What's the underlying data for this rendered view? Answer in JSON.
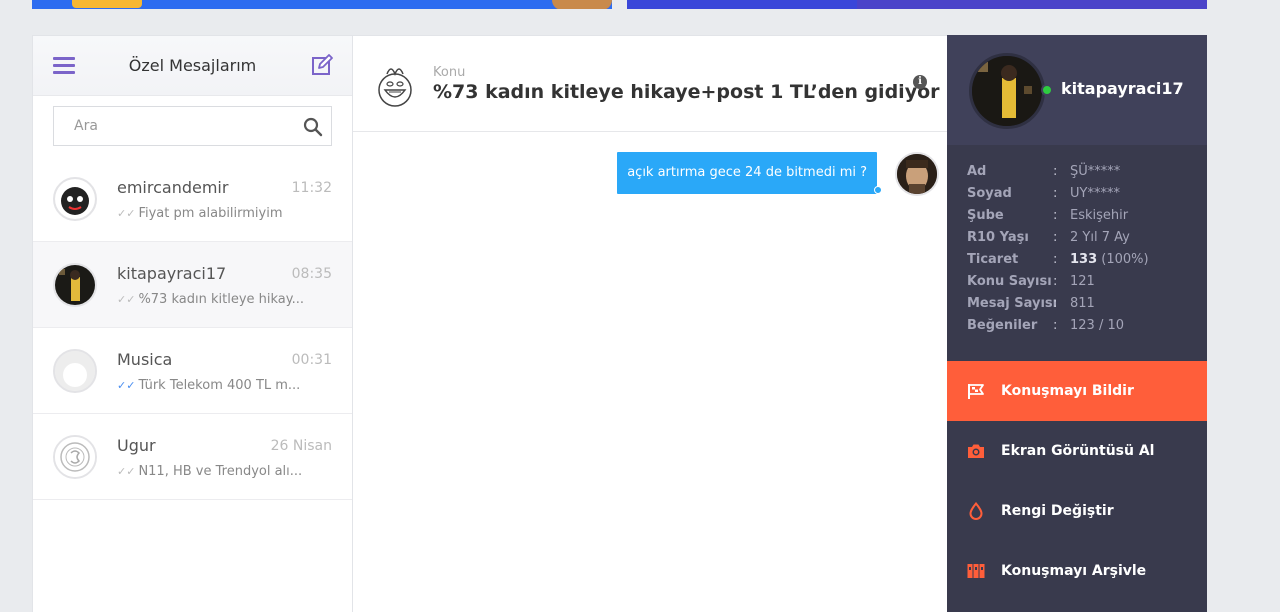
{
  "left_panel": {
    "title": "Özel Mesajlarım",
    "search_placeholder": "Ara",
    "conversations": [
      {
        "name": "emircandemir",
        "time": "11:32",
        "preview": "Fiyat pm alabilirmiyim",
        "read": false
      },
      {
        "name": "kitapayraci17",
        "time": "08:35",
        "preview": "%73 kadın kitleye hikay...",
        "read": false
      },
      {
        "name": "Musica",
        "time": "00:31",
        "preview": "Türk Telekom 400 TL m...",
        "read": true
      },
      {
        "name": "Ugur",
        "time": "26 Nisan",
        "preview": "N11, HB ve Trendyol alı...",
        "read": false
      }
    ]
  },
  "conversation": {
    "topic_label": "Konu",
    "topic_title": "%73 kadın kitleye hikaye+post 1 TL’den gidiyor",
    "info_icon_glyph": "i",
    "messages": [
      {
        "text": "açık artırma gece 24 de bitmedi mi ?",
        "outgoing": true
      }
    ]
  },
  "profile": {
    "username": "kitapayraci17",
    "online": true,
    "separator": ":",
    "fields": [
      {
        "key": "Ad",
        "value": "ŞÜ*****"
      },
      {
        "key": "Soyad",
        "value": "UY*****"
      },
      {
        "key": "Şube",
        "value": "Eskişehir"
      },
      {
        "key": "R10 Yaşı",
        "value": "2 Yıl 7 Ay"
      },
      {
        "key": "Ticaret",
        "value_bold": "133",
        "value_rest": " (100%)"
      },
      {
        "key": "Konu Sayısı",
        "value": "121"
      },
      {
        "key": "Mesaj Sayısı",
        "value": "811"
      },
      {
        "key": "Beğeniler",
        "value": "123 / 10"
      }
    ],
    "actions": [
      {
        "label": "Konuşmayı Bildir",
        "icon": "flag-icon"
      },
      {
        "label": "Ekran Görüntüsü Al",
        "icon": "camera-icon"
      },
      {
        "label": "Rengi Değiştir",
        "icon": "drop-icon"
      },
      {
        "label": "Konuşmayı Arşivle",
        "icon": "archive-icon"
      }
    ]
  },
  "colors": {
    "accent_purple": "#7b64c9",
    "bubble_blue": "#2aa8f8",
    "sidebar_dark": "#393a4d",
    "report_orange": "#ff5e3a",
    "online_green": "#2ecc40"
  }
}
